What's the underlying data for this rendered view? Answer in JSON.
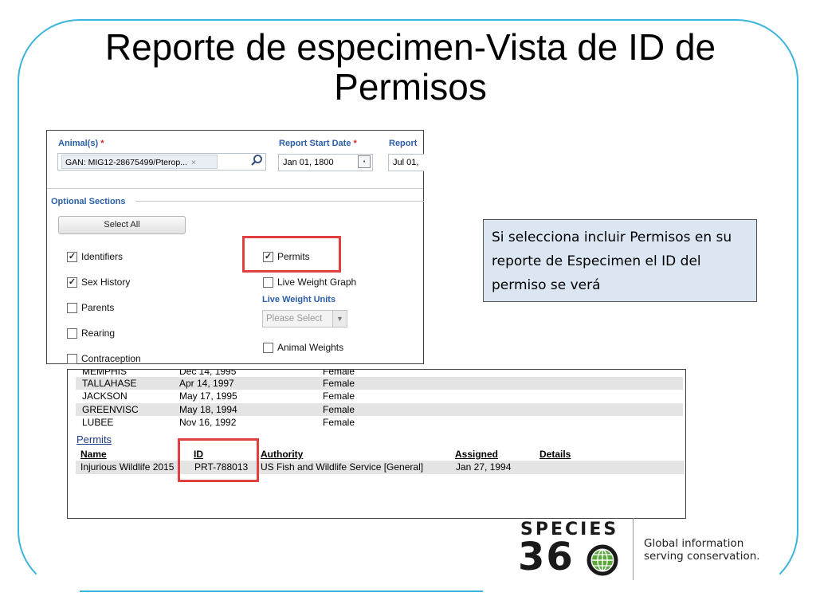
{
  "slide": {
    "title_line1": "Reporte de especimen-Vista de ID de",
    "title_line2": "Permisos"
  },
  "report_form": {
    "animals_label": "Animal(s)",
    "required_marker": "*",
    "animal_tag": "GAN: MIG12-28675499/Pterop...",
    "tag_remove": "×",
    "start_date_label": "Report Start Date",
    "start_date_value": "Jan 01, 1800",
    "end_date_label": "Report",
    "end_date_value": "Jul 01,",
    "optional_sections_label": "Optional Sections",
    "select_all_label": "Select All",
    "sections_left": [
      {
        "label": "Identifiers",
        "checked": true
      },
      {
        "label": "Sex History",
        "checked": true
      },
      {
        "label": "Parents",
        "checked": false
      },
      {
        "label": "Rearing",
        "checked": false
      },
      {
        "label": "Contraception",
        "checked": false
      }
    ],
    "sections_right": [
      {
        "label": "Permits",
        "checked": true
      },
      {
        "label": "Live Weight Graph",
        "checked": false
      },
      {
        "label": "Animal Weights",
        "checked": false
      }
    ],
    "live_weight_units_label": "Live Weight Units",
    "live_weight_units_placeholder": "Please Select",
    "check_glyph": "✓"
  },
  "note": {
    "text": "Si selecciona incluir Permisos en su reporte de Especimen el ID del permiso se verá"
  },
  "report_output": {
    "partial_row": [
      "MEMPHIS",
      "Dec 14, 1995",
      "Female"
    ],
    "rows": [
      {
        "name": "TALLAHASE",
        "date": "Apr 14, 1997",
        "sex": "Female"
      },
      {
        "name": "JACKSON",
        "date": "May 17, 1995",
        "sex": "Female"
      },
      {
        "name": "GREENVISC",
        "date": "May 18, 1994",
        "sex": "Female"
      },
      {
        "name": "LUBEE",
        "date": "Nov 16, 1992",
        "sex": "Female"
      }
    ],
    "permits_title": "Permits",
    "permits_headers": {
      "name": "Name",
      "id": "ID",
      "authority": "Authority",
      "assigned": "Assigned",
      "details": "Details"
    },
    "permits_rows": [
      {
        "name": "Injurious Wildlife 2015",
        "id": "PRT-788013",
        "authority": "US Fish and Wildlife Service [General]",
        "assigned": "Jan 27, 1994",
        "details": ""
      }
    ]
  },
  "logo": {
    "word": "SPECIES",
    "number": "36",
    "tagline_line1": "Global information",
    "tagline_line2": "serving conservation."
  },
  "colors": {
    "frame": "#3cb4dc",
    "highlight": "#e04040",
    "note_bg": "#dce6f2",
    "label_blue": "#2a5fa8"
  }
}
